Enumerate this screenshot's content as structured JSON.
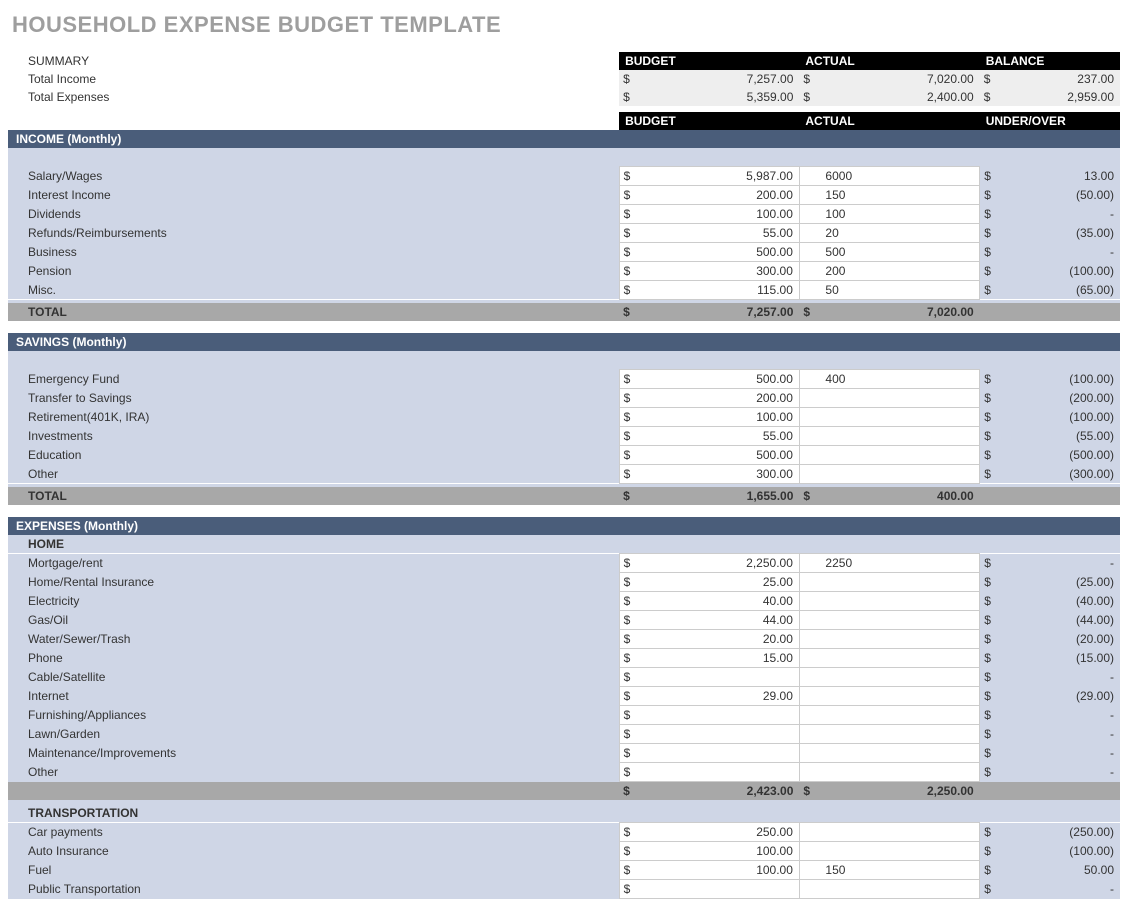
{
  "title": "HOUSEHOLD EXPENSE BUDGET TEMPLATE",
  "summaryLabel": "SUMMARY",
  "headers": {
    "budget": "BUDGET",
    "actual": "ACTUAL",
    "balance": "BALANCE",
    "underover": "UNDER/OVER"
  },
  "summary": [
    {
      "label": "Total Income",
      "b": "7,257.00",
      "a": "7,020.00",
      "u": "237.00"
    },
    {
      "label": "Total Expenses",
      "b": "5,359.00",
      "a": "2,400.00",
      "u": "2,959.00"
    }
  ],
  "sections": [
    {
      "title": "INCOME (Monthly)",
      "rows": [
        {
          "label": "Salary/Wages",
          "b": "5,987.00",
          "a": "6000",
          "u": "13.00"
        },
        {
          "label": "Interest Income",
          "b": "200.00",
          "a": "150",
          "u": "(50.00)"
        },
        {
          "label": "Dividends",
          "b": "100.00",
          "a": "100",
          "u": "-"
        },
        {
          "label": "Refunds/Reimbursements",
          "b": "55.00",
          "a": "20",
          "u": "(35.00)"
        },
        {
          "label": "Business",
          "b": "500.00",
          "a": "500",
          "u": "-"
        },
        {
          "label": "Pension",
          "b": "300.00",
          "a": "200",
          "u": "(100.00)"
        },
        {
          "label": "Misc.",
          "b": "115.00",
          "a": "50",
          "u": "(65.00)"
        }
      ],
      "total": {
        "label": "TOTAL",
        "b": "7,257.00",
        "a": "7,020.00"
      }
    },
    {
      "title": "SAVINGS (Monthly)",
      "rows": [
        {
          "label": "Emergency Fund",
          "b": "500.00",
          "a": "400",
          "u": "(100.00)"
        },
        {
          "label": "Transfer to Savings",
          "b": "200.00",
          "a": "",
          "u": "(200.00)"
        },
        {
          "label": "Retirement(401K, IRA)",
          "b": "100.00",
          "a": "",
          "u": "(100.00)"
        },
        {
          "label": "Investments",
          "b": "55.00",
          "a": "",
          "u": "(55.00)"
        },
        {
          "label": "Education",
          "b": "500.00",
          "a": "",
          "u": "(500.00)"
        },
        {
          "label": "Other",
          "b": "300.00",
          "a": "",
          "u": "(300.00)"
        }
      ],
      "total": {
        "label": "TOTAL",
        "b": "1,655.00",
        "a": "400.00"
      }
    },
    {
      "title": "EXPENSES (Monthly)",
      "groups": [
        {
          "title": "HOME",
          "rows": [
            {
              "label": "Mortgage/rent",
              "b": "2,250.00",
              "a": "2250",
              "u": "-"
            },
            {
              "label": "Home/Rental Insurance",
              "b": "25.00",
              "a": "",
              "u": "(25.00)"
            },
            {
              "label": "Electricity",
              "b": "40.00",
              "a": "",
              "u": "(40.00)"
            },
            {
              "label": "Gas/Oil",
              "b": "44.00",
              "a": "",
              "u": "(44.00)"
            },
            {
              "label": "Water/Sewer/Trash",
              "b": "20.00",
              "a": "",
              "u": "(20.00)"
            },
            {
              "label": "Phone",
              "b": "15.00",
              "a": "",
              "u": "(15.00)"
            },
            {
              "label": "Cable/Satellite",
              "b": "",
              "a": "",
              "u": "-"
            },
            {
              "label": "Internet",
              "b": "29.00",
              "a": "",
              "u": "(29.00)"
            },
            {
              "label": "Furnishing/Appliances",
              "b": "",
              "a": "",
              "u": "-"
            },
            {
              "label": "Lawn/Garden",
              "b": "",
              "a": "",
              "u": "-"
            },
            {
              "label": "Maintenance/Improvements",
              "b": "",
              "a": "",
              "u": "-"
            },
            {
              "label": "Other",
              "b": "",
              "a": "",
              "u": "-"
            }
          ],
          "subtotal": {
            "b": "2,423.00",
            "a": "2,250.00"
          }
        },
        {
          "title": "TRANSPORTATION",
          "rows": [
            {
              "label": "Car payments",
              "b": "250.00",
              "a": "",
              "u": "(250.00)"
            },
            {
              "label": "Auto Insurance",
              "b": "100.00",
              "a": "",
              "u": "(100.00)"
            },
            {
              "label": "Fuel",
              "b": "100.00",
              "a": "150",
              "u": "50.00"
            },
            {
              "label": "Public Transportation",
              "b": "",
              "a": "",
              "u": "-"
            }
          ]
        }
      ]
    }
  ]
}
